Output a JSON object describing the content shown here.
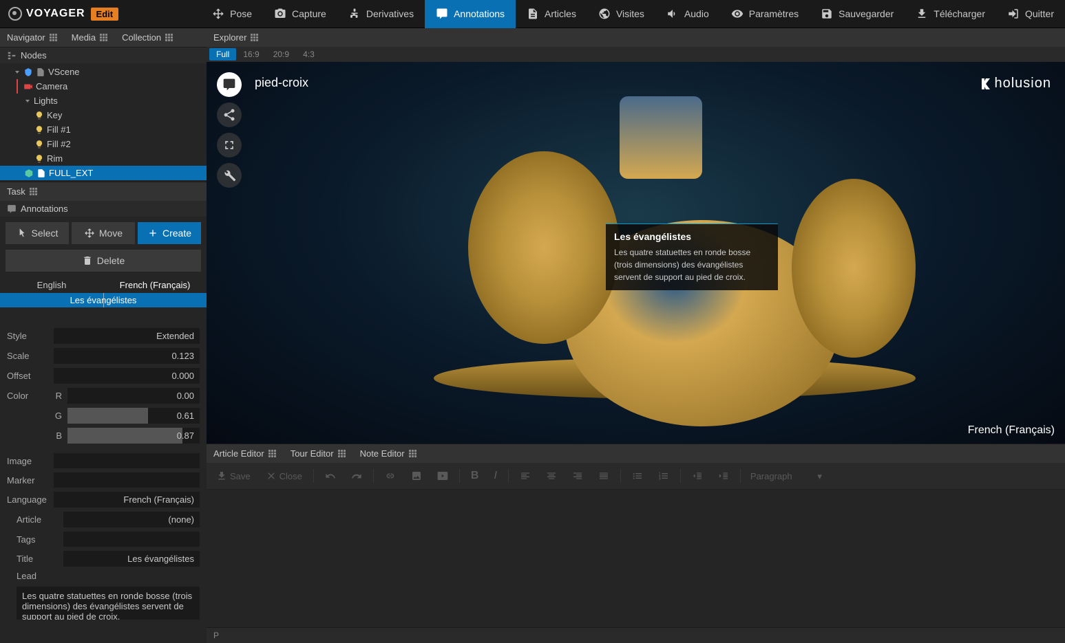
{
  "app": {
    "name": "VOYAGER",
    "mode": "Edit"
  },
  "toolbar": {
    "pose": "Pose",
    "capture": "Capture",
    "derivatives": "Derivatives",
    "annotations": "Annotations",
    "articles": "Articles",
    "visites": "Visites",
    "audio": "Audio",
    "parametres": "Paramètres",
    "sauvegarder": "Sauvegarder",
    "telecharger": "Télécharger",
    "quitter": "Quitter"
  },
  "leftTabs": {
    "navigator": "Navigator",
    "media": "Media",
    "collection": "Collection"
  },
  "tree": {
    "nodes": "Nodes",
    "vscene": "VScene",
    "camera": "Camera",
    "lights": "Lights",
    "key": "Key",
    "fill1": "Fill #1",
    "fill2": "Fill #2",
    "rim": "Rim",
    "full_ext": "FULL_EXT"
  },
  "task": {
    "label": "Task",
    "annotations": "Annotations",
    "select": "Select",
    "move": "Move",
    "create": "Create",
    "delete": "Delete"
  },
  "langTabs": {
    "english": "English",
    "french": "French (Français)"
  },
  "annotList": {
    "item1": "Les évangélistes"
  },
  "props": {
    "style_label": "Style",
    "style_value": "Extended",
    "scale_label": "Scale",
    "scale_value": "0.123",
    "offset_label": "Offset",
    "offset_value": "0.000",
    "color_label": "Color",
    "color_r_label": "R",
    "color_r_value": "0.00",
    "color_g_label": "G",
    "color_g_value": "0.61",
    "color_b_label": "B",
    "color_b_value": "0.87",
    "image_label": "Image",
    "image_value": "",
    "marker_label": "Marker",
    "marker_value": "",
    "language_label": "Language",
    "language_value": "French (Français)",
    "article_label": "Article",
    "article_value": "(none)",
    "tags_label": "Tags",
    "tags_value": "",
    "title_label": "Title",
    "title_value": "Les évangélistes",
    "lead_label": "Lead",
    "lead_value": "Les quatre statuettes en ronde bosse (trois dimensions) des évangélistes servent de support au pied de croix."
  },
  "explorer": {
    "tab": "Explorer",
    "full": "Full",
    "r169": "16:9",
    "r209": "20:9",
    "r43": "4:3"
  },
  "viewport": {
    "title": "pied-croix",
    "logo": "holusion",
    "lang": "French (Français)"
  },
  "annotOverlay": {
    "title": "Les évangélistes",
    "text": "Les quatre statuettes en ronde bosse (trois dimensions) des évangélistes servent de support au pied de croix."
  },
  "editor": {
    "articleEditor": "Article Editor",
    "tourEditor": "Tour Editor",
    "noteEditor": "Note Editor",
    "save": "Save",
    "close": "Close",
    "paragraph": "Paragraph",
    "status": "P"
  }
}
